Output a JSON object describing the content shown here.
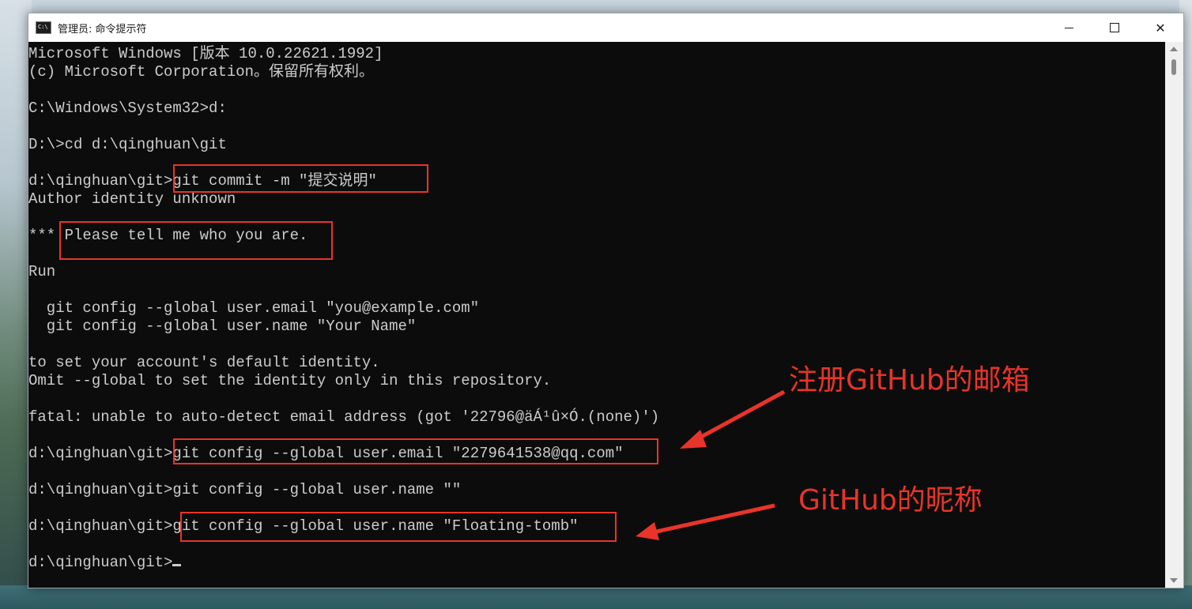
{
  "window": {
    "title": "管理员: 命令提示符",
    "icon": "cmd-icon",
    "controls": {
      "minimize_icon": "minimize-icon",
      "maximize_icon": "maximize-icon",
      "close_icon": "close-icon",
      "close_glyph": "✕"
    }
  },
  "console": {
    "lines": [
      "Microsoft Windows [版本 10.0.22621.1992]",
      "(c) Microsoft Corporation。保留所有权利。",
      "",
      "C:\\Windows\\System32>d:",
      "",
      "D:\\>cd d:\\qinghuan\\git",
      "",
      "d:\\qinghuan\\git>git commit -m \"提交说明\"",
      "Author identity unknown",
      "",
      "*** Please tell me who you are.",
      "",
      "Run",
      "",
      "  git config --global user.email \"you@example.com\"",
      "  git config --global user.name \"Your Name\"",
      "",
      "to set your account's default identity.",
      "Omit --global to set the identity only in this repository.",
      "",
      "fatal: unable to auto-detect email address (got '22796@äÁ¹û×Ó.(none)')",
      "",
      "d:\\qinghuan\\git>git config --global user.email \"2279641538@qq.com\"",
      "",
      "d:\\qinghuan\\git>git config --global user.name \"\"",
      "",
      "d:\\qinghuan\\git>git config --global user.name \"Floating-tomb\"",
      "",
      "d:\\qinghuan\\git>"
    ]
  },
  "annotations": {
    "email_label": "注册GitHub的邮箱",
    "nickname_label": "GitHub的昵称",
    "color": "#e8342a"
  }
}
